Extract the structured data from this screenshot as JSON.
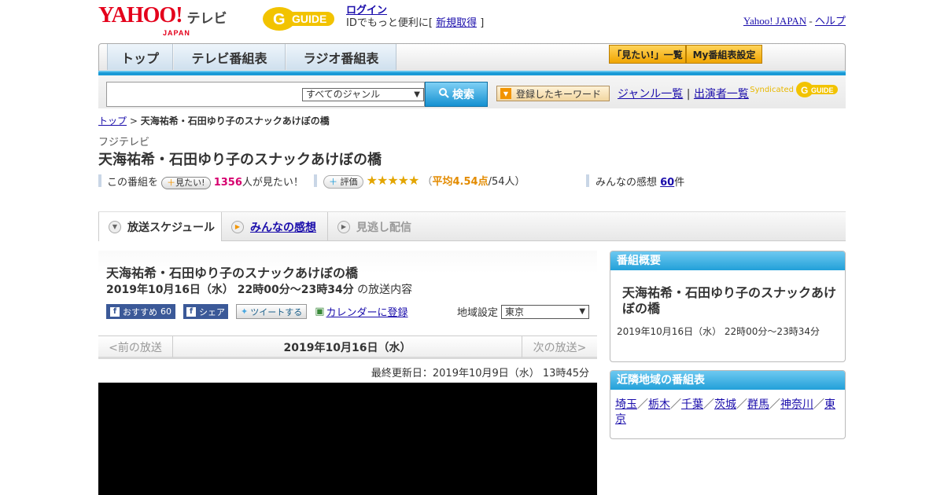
{
  "header": {
    "logo_yahoo": "YAHOO!",
    "logo_japan": "JAPAN",
    "logo_tv": "テレビ",
    "logo_gguide": "G GUIDE",
    "login": "ログイン",
    "login_desc_prefix": "IDでもっと便利に[ ",
    "register": "新規取得",
    "login_desc_suffix": " ]",
    "yahoo_japan_link": "Yahoo! JAPAN",
    "dash": " - ",
    "help_link": "ヘルプ"
  },
  "nav": {
    "tabs": [
      "トップ",
      "テレビ番組表",
      "ラジオ番組表"
    ],
    "mitai_list": "「見たい!」一覧",
    "my_settings": "My番組表設定"
  },
  "search": {
    "genre_selected": "すべてのジャンル",
    "button": "検索",
    "keyword_button": "登録したキーワード",
    "genre_list": "ジャンル一覧",
    "pipe": "|",
    "performer_list": "出演者一覧",
    "syndicated": "Syndicated",
    "gguide": "G GUIDE"
  },
  "breadcrumb": {
    "top": "トップ",
    "separator": " > ",
    "current": "天海祐希・石田ゆり子のスナックあけぼの橋"
  },
  "program": {
    "station": "フジテレビ",
    "title": "天海祐希・石田ゆり子のスナックあけぼの橋"
  },
  "infobar": {
    "prefix": "この番組を",
    "mitai_btn": "見たい!",
    "count": "1356",
    "count_suffix": "人が見たい！",
    "hyoka_btn": "評価",
    "stars": "★★★★★",
    "rating_prefix": "（",
    "rating_avg": "平均4.54点",
    "rating_suffix": "/54人）",
    "impressions_prefix": "みんなの感想 ",
    "impressions_count": "60",
    "impressions_suffix": "件",
    "rating_value": 4.54
  },
  "content_tabs": [
    "放送スケジュール",
    "みんなの感想",
    "見逃し配信"
  ],
  "main": {
    "title": "天海祐希・石田ゆり子のスナックあけぼの橋",
    "date": "2019年10月16日（水） 22時00分～23時34分",
    "date_suffix": " の放送内容",
    "fb_recommend": "おすすめ",
    "fb_count": "60",
    "fb_share": "シェア",
    "tweet": "ツイートする",
    "calendar": "カレンダーに登録",
    "region_label": "地域設定",
    "region_value": "東京",
    "prev": "<前の放送",
    "pager_date": "2019年10月16日（水）",
    "next": "次の放送>",
    "updated": "最終更新日：2019年10月9日（水） 13時45分"
  },
  "side": {
    "overview_header": "番組概要",
    "overview_title": "天海祐希・石田ゆり子のスナックあけぼの橋",
    "overview_date": "2019年10月16日（水） 22時00分～23時34分",
    "nearby_header": "近隣地域の番組表",
    "regions": [
      "埼玉",
      "栃木",
      "千葉",
      "茨城",
      "群馬",
      "神奈川",
      "東京"
    ],
    "region_sep": "／"
  },
  "colors": {
    "accent_blue": "#1a9ad6",
    "yahoo_red": "#e4001b",
    "count_pink": "#d6006e",
    "star_gold": "#e3a500"
  }
}
